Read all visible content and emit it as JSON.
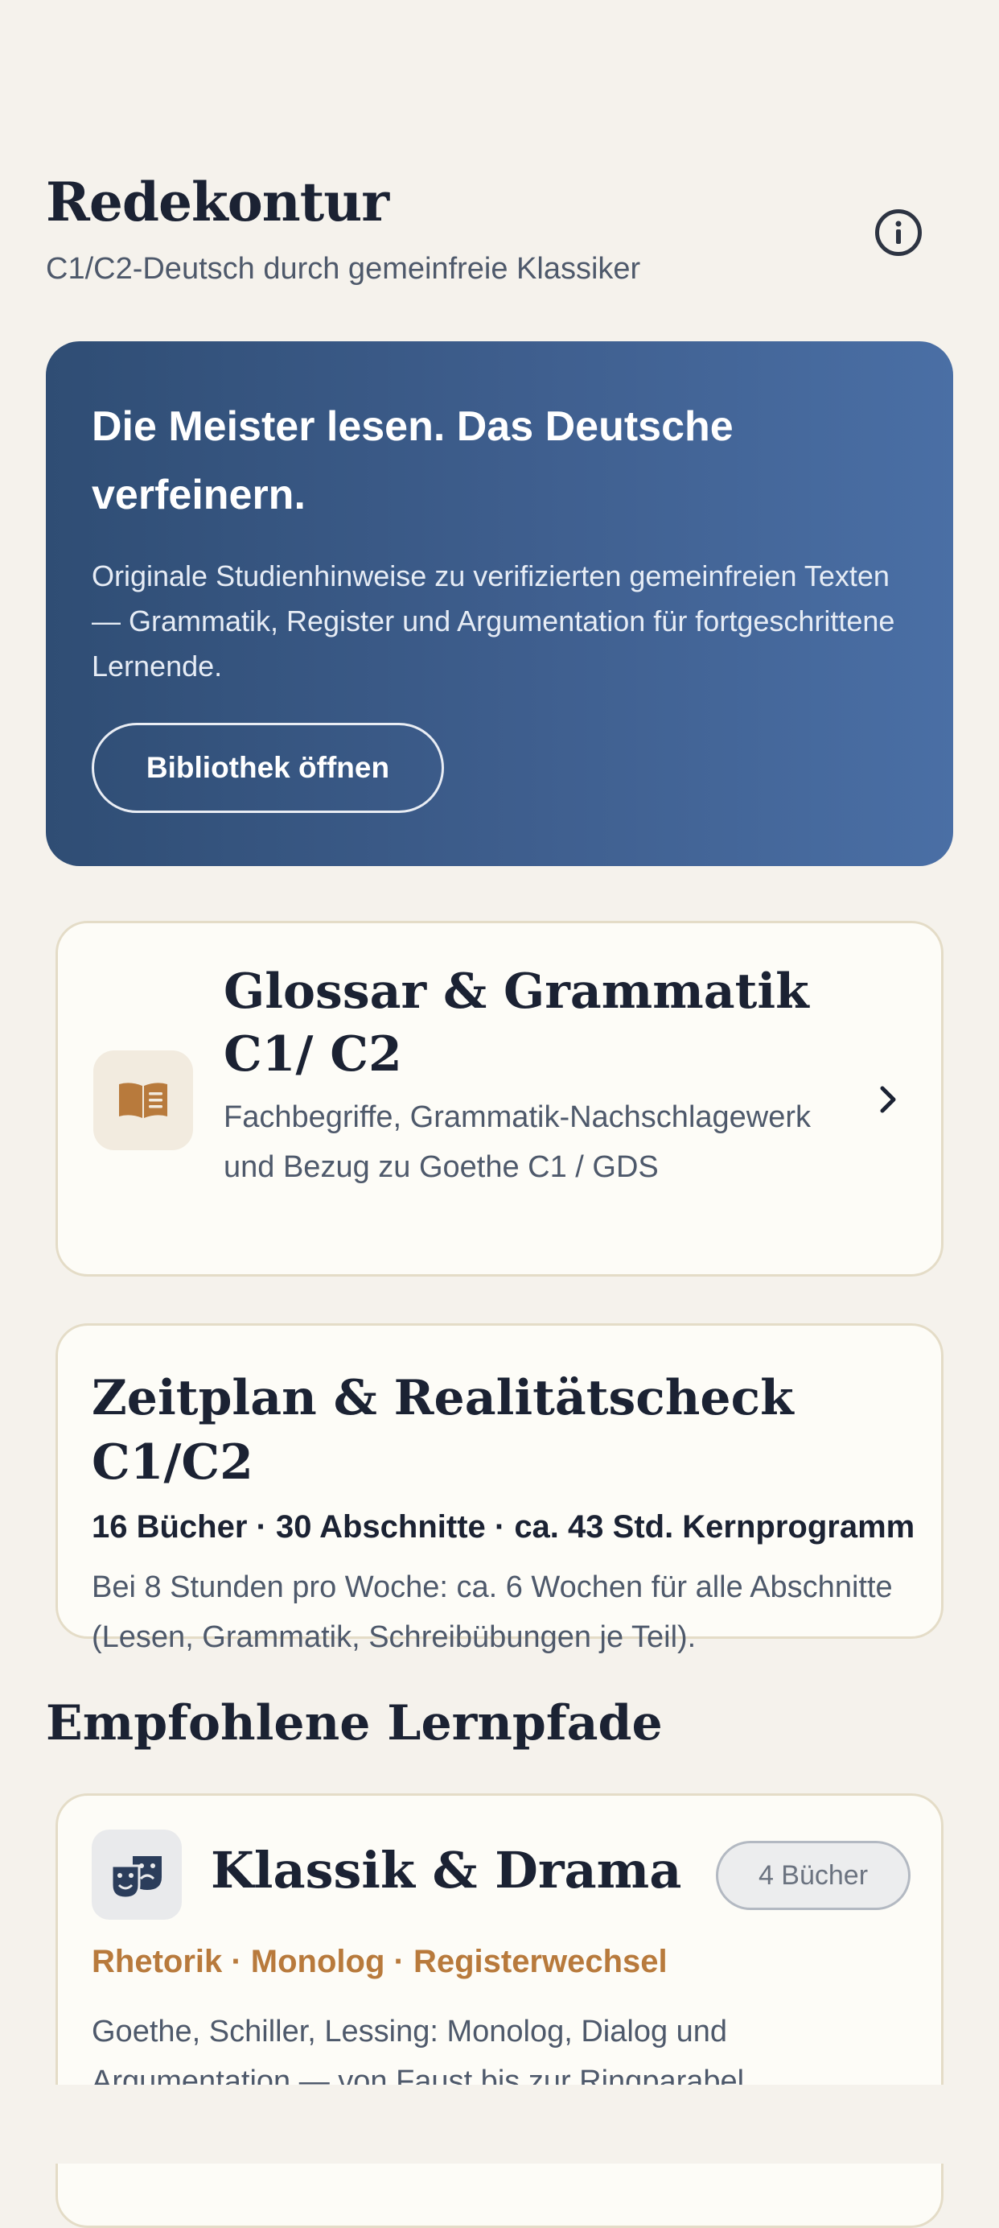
{
  "header": {
    "title": "Redekontur",
    "subtitle": "C1/C2-Deutsch durch gemeinfreie Klassiker"
  },
  "hero": {
    "title": "Die Meister lesen. Das Deutsche verfeinern.",
    "text": "Originale Studienhinweise zu verifizierten gemeinfreien Texten — Grammatik, Register und Argumentation für fortgeschrittene Lernende.",
    "button_label": "Bibliothek öffnen"
  },
  "glossar": {
    "title": "Glossar & Grammatik C1/ C2",
    "description": "Fachbegriffe, Grammatik-Nachschlagewerk und Bezug zu Goethe C1 / GDS",
    "icon": "book-icon"
  },
  "zeitplan": {
    "title": "Zeitplan & Realitätscheck C1/C2",
    "stats": "16 Bücher · 30 Abschnitte · ca. 43 Std. Kernprogramm",
    "description": "Bei 8 Stunden pro Woche: ca. 6 Wochen für alle Abschnitte (Lesen, Grammatik, Schreibübungen je Teil)."
  },
  "section": {
    "heading": "Empfohlene Lernpfade"
  },
  "path": {
    "title": "Klassik & Drama",
    "badge": "4 Bücher",
    "tags": "Rhetorik · Monolog · Registerwechsel",
    "description": "Goethe, Schiller, Lessing: Monolog, Dialog und Argumentation — von Faust bis zur Ringparabel.",
    "icon": "theater-masks-icon"
  },
  "colors": {
    "background": "#f5f2ec",
    "hero_start": "#2f4d74",
    "hero_end": "#4a6fa5",
    "accent": "#b87a3c",
    "card_border": "#e4dcc7"
  }
}
